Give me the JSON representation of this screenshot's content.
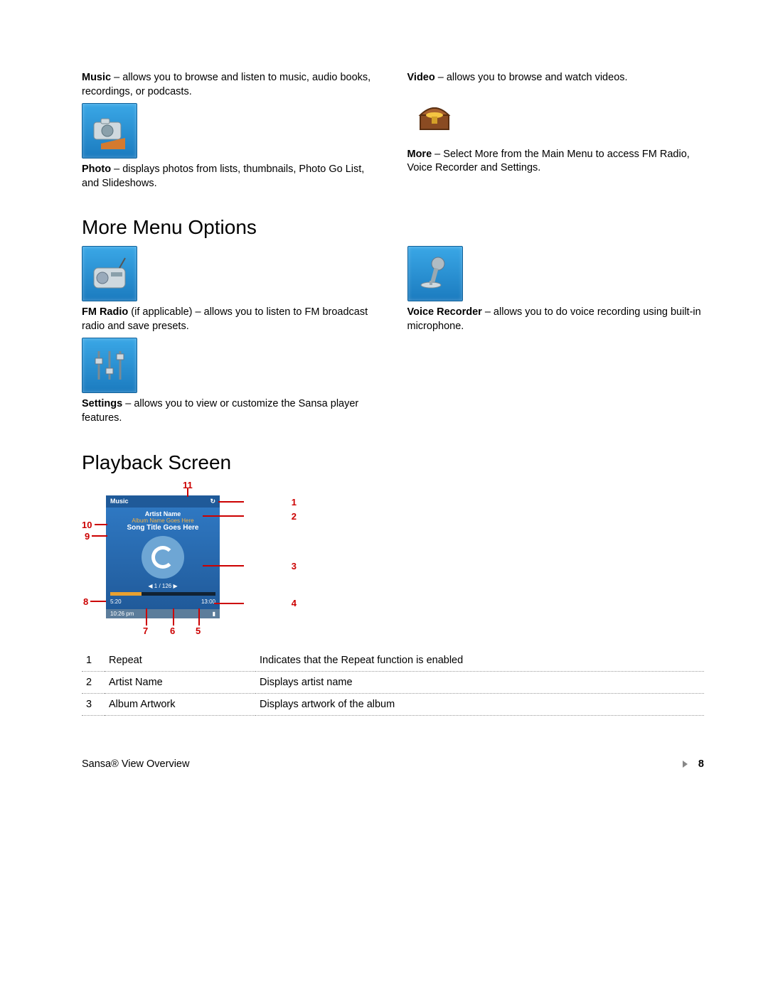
{
  "top": {
    "left": {
      "music": {
        "label": "Music",
        "text": " – allows you to browse and listen to music, audio books, recordings, or podcasts."
      },
      "photo": {
        "label": "Photo",
        "text": " – displays photos from lists, thumbnails, Photo Go List, and Slideshows."
      }
    },
    "right": {
      "video": {
        "label": "Video",
        "text": " – allows you to browse and watch videos."
      },
      "more": {
        "label": "More",
        "text": " – Select More from the Main Menu to access FM Radio, Voice Recorder and Settings."
      }
    }
  },
  "heading_more": "More Menu Options",
  "more_section": {
    "left": {
      "fm": {
        "label": "FM Radio",
        "text": " (if applicable) – allows you to listen to FM broadcast radio and save presets."
      },
      "settings": {
        "label": "Settings",
        "text": " – allows you to view or customize the Sansa player features."
      }
    },
    "right": {
      "voice": {
        "label": "Voice Recorder",
        "text": " – allows you to do voice recording using built-in microphone."
      }
    }
  },
  "heading_playback": "Playback Screen",
  "playback_screen": {
    "header": "Music",
    "artist": "Artist Name",
    "album": "Album Name Goes Here",
    "song": "Song Title Goes Here",
    "track": "1 / 126",
    "time_left": "5:20",
    "time_right": "13:00",
    "clock": "10:26 pm"
  },
  "callouts": {
    "c1": "1",
    "c2": "2",
    "c3": "3",
    "c4": "4",
    "c5": "5",
    "c6": "6",
    "c7": "7",
    "c8": "8",
    "c9": "9",
    "c10": "10",
    "c11": "11"
  },
  "table": [
    {
      "n": "1",
      "label": "Repeat",
      "desc": "Indicates that the Repeat function is enabled"
    },
    {
      "n": "2",
      "label": "Artist Name",
      "desc": "Displays artist name"
    },
    {
      "n": "3",
      "label": "Album Artwork",
      "desc": "Displays artwork of the album"
    }
  ],
  "footer": {
    "left": "Sansa® View Overview",
    "page": "8"
  }
}
